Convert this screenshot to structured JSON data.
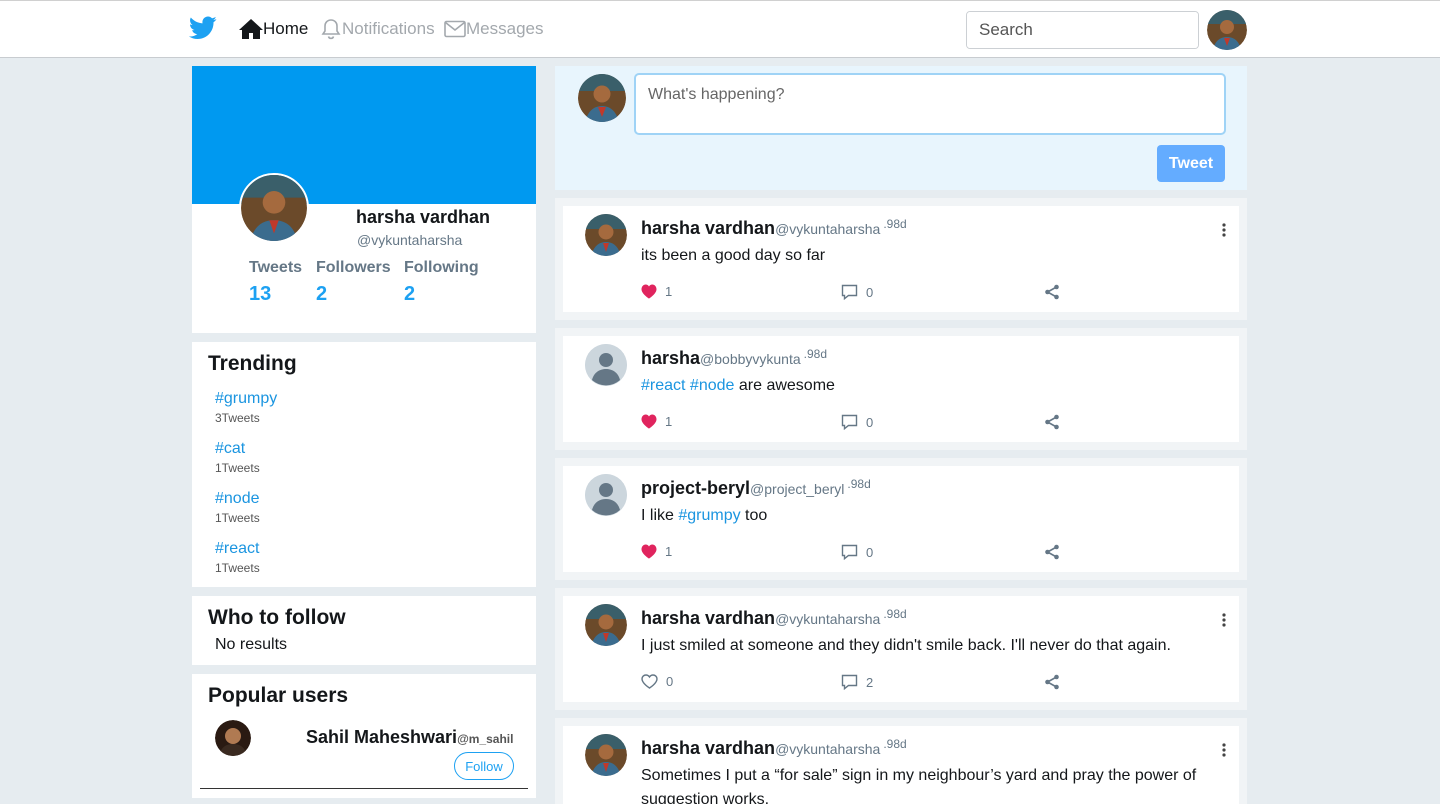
{
  "nav": {
    "home": "Home",
    "notifications": "Notifications",
    "messages": "Messages",
    "search_placeholder": "Search"
  },
  "profile": {
    "name": "harsha vardhan",
    "handle": "@vykuntaharsha",
    "stats": [
      {
        "label": "Tweets",
        "value": "13"
      },
      {
        "label": "Followers",
        "value": "2"
      },
      {
        "label": "Following",
        "value": "2"
      }
    ]
  },
  "trending": {
    "title": "Trending",
    "items": [
      {
        "tag": "#grumpy",
        "count": "3Tweets"
      },
      {
        "tag": "#cat",
        "count": "1Tweets"
      },
      {
        "tag": "#node",
        "count": "1Tweets"
      },
      {
        "tag": "#react",
        "count": "1Tweets"
      }
    ]
  },
  "who_to_follow": {
    "title": "Who to follow",
    "empty": "No results"
  },
  "popular_users": {
    "title": "Popular users",
    "items": [
      {
        "name": "Sahil Maheshwari",
        "handle": "@m_sahil",
        "follow_label": "Follow"
      }
    ]
  },
  "compose": {
    "placeholder": "What's happening?",
    "button": "Tweet"
  },
  "tweets": [
    {
      "name": "harsha vardhan",
      "handle": "@vykuntaharsha",
      "time": ".98d",
      "text_parts": [
        "its been a good day so far"
      ],
      "likes": "1",
      "liked": true,
      "replies": "0",
      "menu": true,
      "avatar": "photo"
    },
    {
      "name": "harsha",
      "handle": "@bobbyvykunta",
      "time": ".98d",
      "text_parts": [
        "#react",
        " ",
        "#node",
        " are awesome"
      ],
      "likes": "1",
      "liked": true,
      "replies": "0",
      "menu": false,
      "avatar": "default"
    },
    {
      "name": "project-beryl",
      "handle": "@project_beryl",
      "time": ".98d",
      "text_parts": [
        "I like ",
        "#grumpy",
        " too"
      ],
      "likes": "1",
      "liked": true,
      "replies": "0",
      "menu": false,
      "avatar": "default"
    },
    {
      "name": "harsha vardhan",
      "handle": "@vykuntaharsha",
      "time": ".98d",
      "text_parts": [
        "I just smiled at someone and they didn't smile back. I'll never do that again."
      ],
      "likes": "0",
      "liked": false,
      "replies": "2",
      "menu": true,
      "avatar": "photo"
    },
    {
      "name": "harsha vardhan",
      "handle": "@vykuntaharsha",
      "time": ".98d",
      "text_parts": [
        "Sometimes I put a “for sale” sign in my neighbour’s yard and pray the power of suggestion works."
      ],
      "likes": "",
      "liked": false,
      "replies": "",
      "menu": true,
      "avatar": "photo"
    }
  ],
  "colors": {
    "accent": "#1da1f2",
    "banner": "#0099f0",
    "heart": "#e0245e",
    "background": "#e6ecf0"
  }
}
